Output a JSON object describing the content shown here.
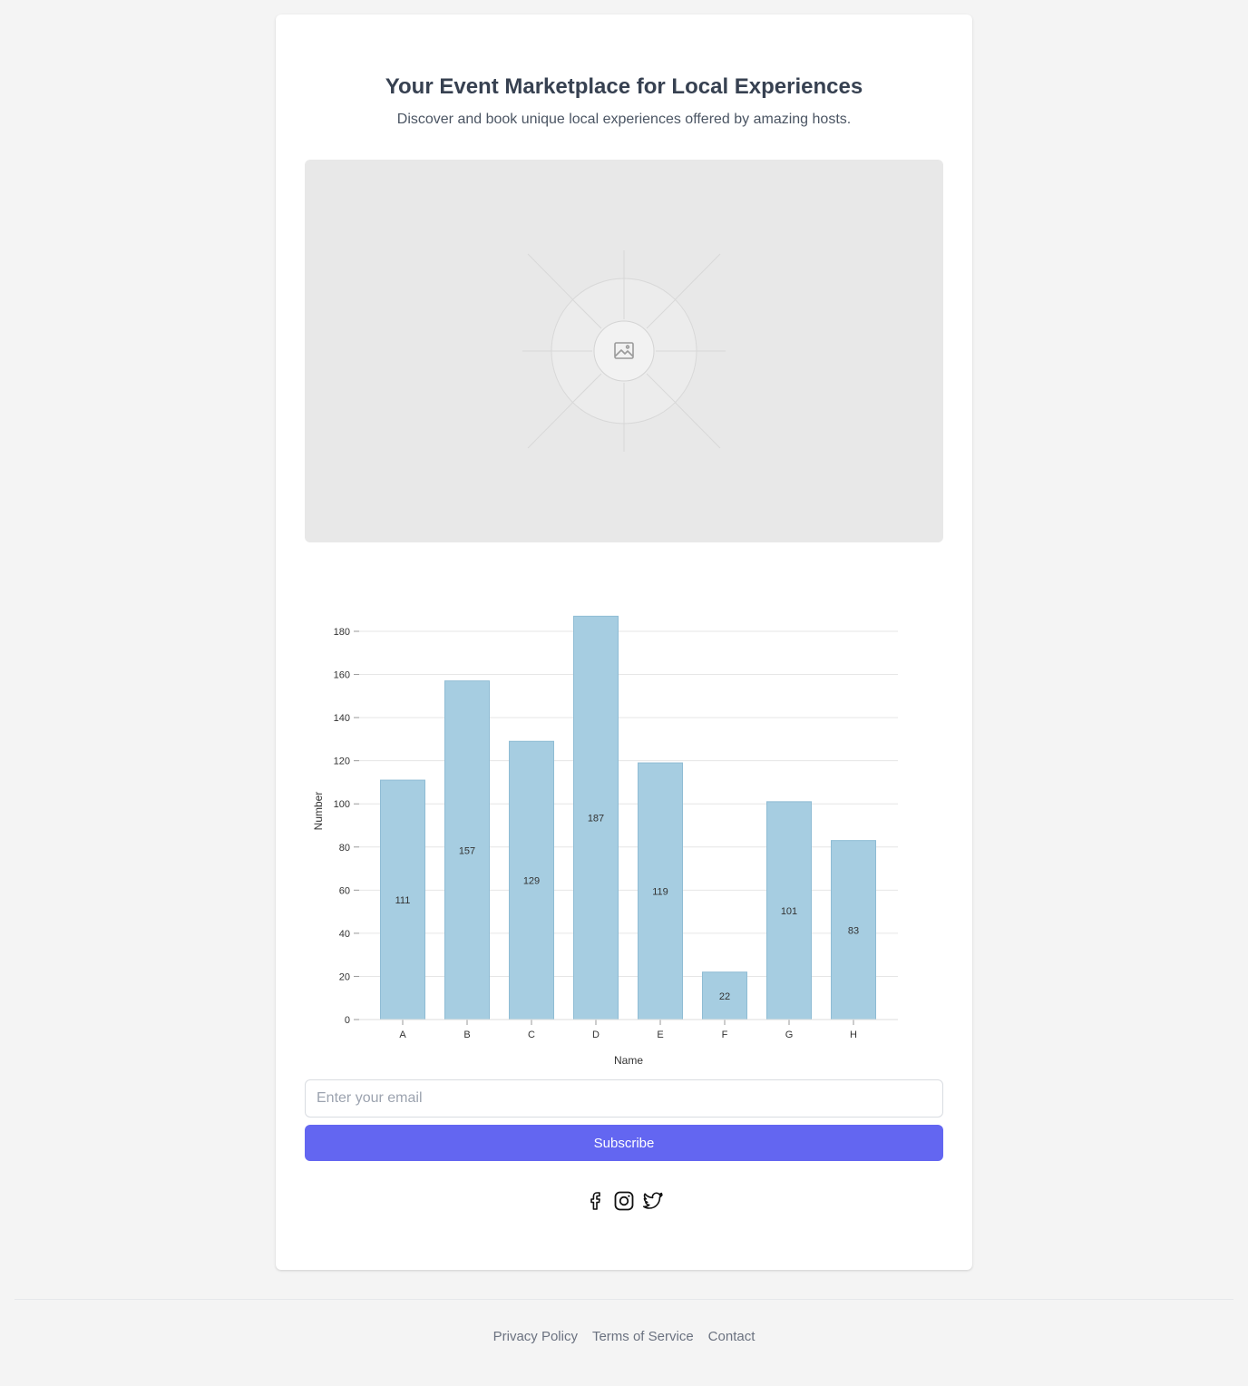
{
  "header": {
    "title": "Your Event Marketplace for Local Experiences",
    "subtitle": "Discover and book unique local experiences offered by amazing hosts."
  },
  "hero": {
    "icon": "image-placeholder-icon",
    "background": "#e8e8e8"
  },
  "chart_data": {
    "type": "bar",
    "categories": [
      "A",
      "B",
      "C",
      "D",
      "E",
      "F",
      "G",
      "H"
    ],
    "values": [
      111,
      157,
      129,
      187,
      119,
      22,
      101,
      83
    ],
    "xlabel": "Name",
    "ylabel": "Number",
    "ylim": [
      0,
      180
    ],
    "yticks": [
      0,
      20,
      40,
      60,
      80,
      100,
      120,
      140,
      160,
      180
    ],
    "grid": true,
    "bar_color": "#a6cde1",
    "data_labels": true
  },
  "subscribe": {
    "placeholder": "Enter your email",
    "button_label": "Subscribe",
    "accent": "#6366f1"
  },
  "socials": [
    {
      "name": "facebook-icon"
    },
    {
      "name": "instagram-icon"
    },
    {
      "name": "twitter-icon"
    }
  ],
  "footer": {
    "links": [
      "Privacy Policy",
      "Terms of Service",
      "Contact"
    ]
  }
}
